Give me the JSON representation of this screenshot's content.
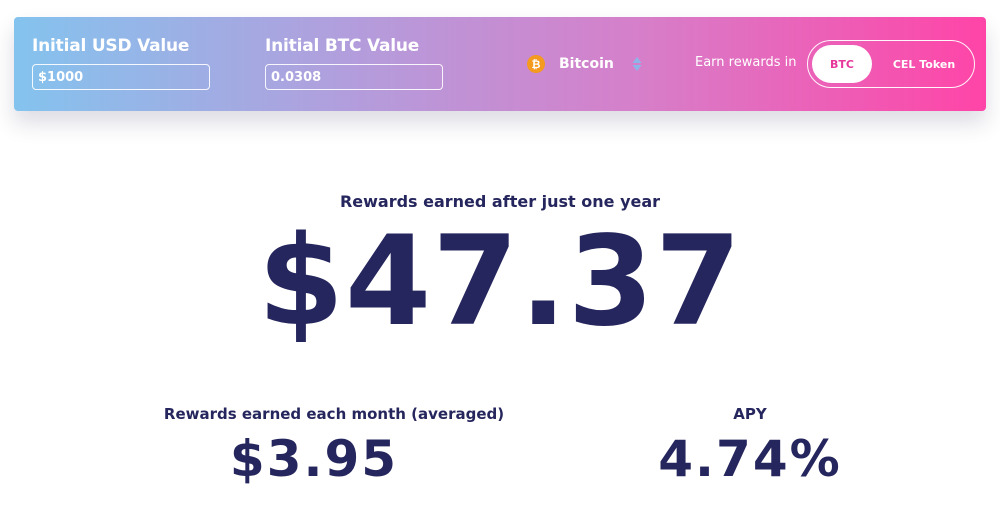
{
  "top_bar": {
    "usd": {
      "label": "Initial USD Value",
      "value": "$1000"
    },
    "btc": {
      "label": "Initial BTC Value",
      "value": "0.0308"
    },
    "coin_select": {
      "icon": "bitcoin-icon",
      "icon_glyph": "₿",
      "name": "Bitcoin",
      "icon_color": "#f39a1f"
    },
    "earn_rewards_label": "Earn rewards in",
    "toggle": {
      "options": [
        "BTC",
        "CEL Token"
      ],
      "selected": "BTC"
    },
    "gradient": [
      "#84c3ee",
      "#ff44a7"
    ]
  },
  "results": {
    "year_label": "Rewards earned after just one year",
    "year_value": "$47.37",
    "month_label": "Rewards earned each month (averaged)",
    "month_value": "$3.95",
    "apy_label": "APY",
    "apy_value": "4.74%"
  },
  "colors": {
    "text_dark": "#26265e",
    "accent_pink": "#e7379b"
  }
}
